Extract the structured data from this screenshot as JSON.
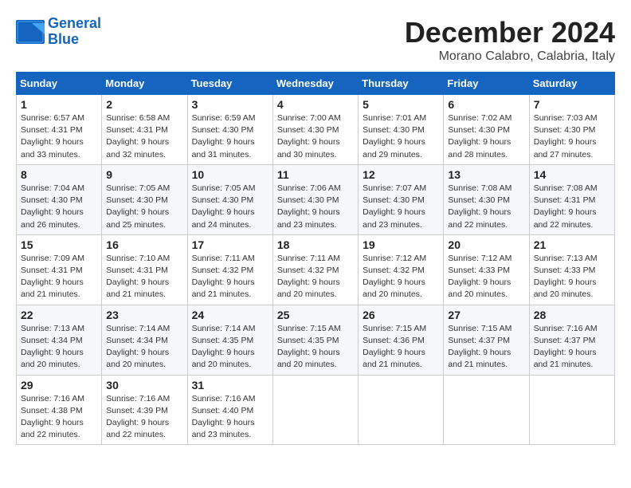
{
  "logo": {
    "line1": "General",
    "line2": "Blue"
  },
  "title": "December 2024",
  "location": "Morano Calabro, Calabria, Italy",
  "weekdays": [
    "Sunday",
    "Monday",
    "Tuesday",
    "Wednesday",
    "Thursday",
    "Friday",
    "Saturday"
  ],
  "weeks": [
    [
      {
        "day": "1",
        "sunrise": "Sunrise: 6:57 AM",
        "sunset": "Sunset: 4:31 PM",
        "daylight": "Daylight: 9 hours and 33 minutes."
      },
      {
        "day": "2",
        "sunrise": "Sunrise: 6:58 AM",
        "sunset": "Sunset: 4:31 PM",
        "daylight": "Daylight: 9 hours and 32 minutes."
      },
      {
        "day": "3",
        "sunrise": "Sunrise: 6:59 AM",
        "sunset": "Sunset: 4:30 PM",
        "daylight": "Daylight: 9 hours and 31 minutes."
      },
      {
        "day": "4",
        "sunrise": "Sunrise: 7:00 AM",
        "sunset": "Sunset: 4:30 PM",
        "daylight": "Daylight: 9 hours and 30 minutes."
      },
      {
        "day": "5",
        "sunrise": "Sunrise: 7:01 AM",
        "sunset": "Sunset: 4:30 PM",
        "daylight": "Daylight: 9 hours and 29 minutes."
      },
      {
        "day": "6",
        "sunrise": "Sunrise: 7:02 AM",
        "sunset": "Sunset: 4:30 PM",
        "daylight": "Daylight: 9 hours and 28 minutes."
      },
      {
        "day": "7",
        "sunrise": "Sunrise: 7:03 AM",
        "sunset": "Sunset: 4:30 PM",
        "daylight": "Daylight: 9 hours and 27 minutes."
      }
    ],
    [
      {
        "day": "8",
        "sunrise": "Sunrise: 7:04 AM",
        "sunset": "Sunset: 4:30 PM",
        "daylight": "Daylight: 9 hours and 26 minutes."
      },
      {
        "day": "9",
        "sunrise": "Sunrise: 7:05 AM",
        "sunset": "Sunset: 4:30 PM",
        "daylight": "Daylight: 9 hours and 25 minutes."
      },
      {
        "day": "10",
        "sunrise": "Sunrise: 7:05 AM",
        "sunset": "Sunset: 4:30 PM",
        "daylight": "Daylight: 9 hours and 24 minutes."
      },
      {
        "day": "11",
        "sunrise": "Sunrise: 7:06 AM",
        "sunset": "Sunset: 4:30 PM",
        "daylight": "Daylight: 9 hours and 23 minutes."
      },
      {
        "day": "12",
        "sunrise": "Sunrise: 7:07 AM",
        "sunset": "Sunset: 4:30 PM",
        "daylight": "Daylight: 9 hours and 23 minutes."
      },
      {
        "day": "13",
        "sunrise": "Sunrise: 7:08 AM",
        "sunset": "Sunset: 4:30 PM",
        "daylight": "Daylight: 9 hours and 22 minutes."
      },
      {
        "day": "14",
        "sunrise": "Sunrise: 7:08 AM",
        "sunset": "Sunset: 4:31 PM",
        "daylight": "Daylight: 9 hours and 22 minutes."
      }
    ],
    [
      {
        "day": "15",
        "sunrise": "Sunrise: 7:09 AM",
        "sunset": "Sunset: 4:31 PM",
        "daylight": "Daylight: 9 hours and 21 minutes."
      },
      {
        "day": "16",
        "sunrise": "Sunrise: 7:10 AM",
        "sunset": "Sunset: 4:31 PM",
        "daylight": "Daylight: 9 hours and 21 minutes."
      },
      {
        "day": "17",
        "sunrise": "Sunrise: 7:11 AM",
        "sunset": "Sunset: 4:32 PM",
        "daylight": "Daylight: 9 hours and 21 minutes."
      },
      {
        "day": "18",
        "sunrise": "Sunrise: 7:11 AM",
        "sunset": "Sunset: 4:32 PM",
        "daylight": "Daylight: 9 hours and 20 minutes."
      },
      {
        "day": "19",
        "sunrise": "Sunrise: 7:12 AM",
        "sunset": "Sunset: 4:32 PM",
        "daylight": "Daylight: 9 hours and 20 minutes."
      },
      {
        "day": "20",
        "sunrise": "Sunrise: 7:12 AM",
        "sunset": "Sunset: 4:33 PM",
        "daylight": "Daylight: 9 hours and 20 minutes."
      },
      {
        "day": "21",
        "sunrise": "Sunrise: 7:13 AM",
        "sunset": "Sunset: 4:33 PM",
        "daylight": "Daylight: 9 hours and 20 minutes."
      }
    ],
    [
      {
        "day": "22",
        "sunrise": "Sunrise: 7:13 AM",
        "sunset": "Sunset: 4:34 PM",
        "daylight": "Daylight: 9 hours and 20 minutes."
      },
      {
        "day": "23",
        "sunrise": "Sunrise: 7:14 AM",
        "sunset": "Sunset: 4:34 PM",
        "daylight": "Daylight: 9 hours and 20 minutes."
      },
      {
        "day": "24",
        "sunrise": "Sunrise: 7:14 AM",
        "sunset": "Sunset: 4:35 PM",
        "daylight": "Daylight: 9 hours and 20 minutes."
      },
      {
        "day": "25",
        "sunrise": "Sunrise: 7:15 AM",
        "sunset": "Sunset: 4:35 PM",
        "daylight": "Daylight: 9 hours and 20 minutes."
      },
      {
        "day": "26",
        "sunrise": "Sunrise: 7:15 AM",
        "sunset": "Sunset: 4:36 PM",
        "daylight": "Daylight: 9 hours and 21 minutes."
      },
      {
        "day": "27",
        "sunrise": "Sunrise: 7:15 AM",
        "sunset": "Sunset: 4:37 PM",
        "daylight": "Daylight: 9 hours and 21 minutes."
      },
      {
        "day": "28",
        "sunrise": "Sunrise: 7:16 AM",
        "sunset": "Sunset: 4:37 PM",
        "daylight": "Daylight: 9 hours and 21 minutes."
      }
    ],
    [
      {
        "day": "29",
        "sunrise": "Sunrise: 7:16 AM",
        "sunset": "Sunset: 4:38 PM",
        "daylight": "Daylight: 9 hours and 22 minutes."
      },
      {
        "day": "30",
        "sunrise": "Sunrise: 7:16 AM",
        "sunset": "Sunset: 4:39 PM",
        "daylight": "Daylight: 9 hours and 22 minutes."
      },
      {
        "day": "31",
        "sunrise": "Sunrise: 7:16 AM",
        "sunset": "Sunset: 4:40 PM",
        "daylight": "Daylight: 9 hours and 23 minutes."
      },
      null,
      null,
      null,
      null
    ]
  ]
}
